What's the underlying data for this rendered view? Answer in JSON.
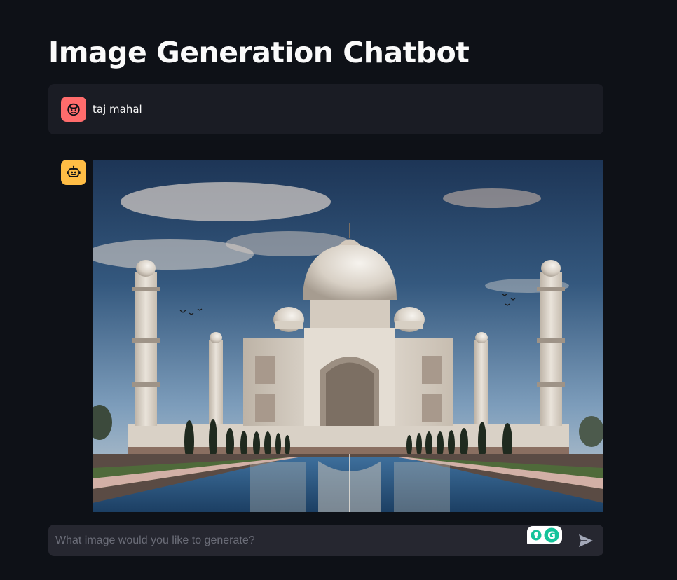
{
  "header": {
    "title": "Image Generation Chatbot"
  },
  "messages": [
    {
      "role": "user",
      "avatar_icon": "user-face-icon",
      "avatar_color": "#ff6c6c",
      "text": "taj mahal"
    },
    {
      "role": "assistant",
      "avatar_icon": "robot-icon",
      "avatar_color": "#ffbd45",
      "content": "generated-image-taj-mahal"
    }
  ],
  "chat_input": {
    "placeholder": "What image would you like to generate?",
    "value": "",
    "extension_icon": "grammarly-icon",
    "send_icon": "send-arrow-icon"
  },
  "colors": {
    "background": "#0e1117",
    "message_bg": "#1a1c24",
    "input_bg": "#262730",
    "user_avatar": "#ff6c6c",
    "bot_avatar": "#ffbd45",
    "grammarly_green": "#15c39a"
  }
}
